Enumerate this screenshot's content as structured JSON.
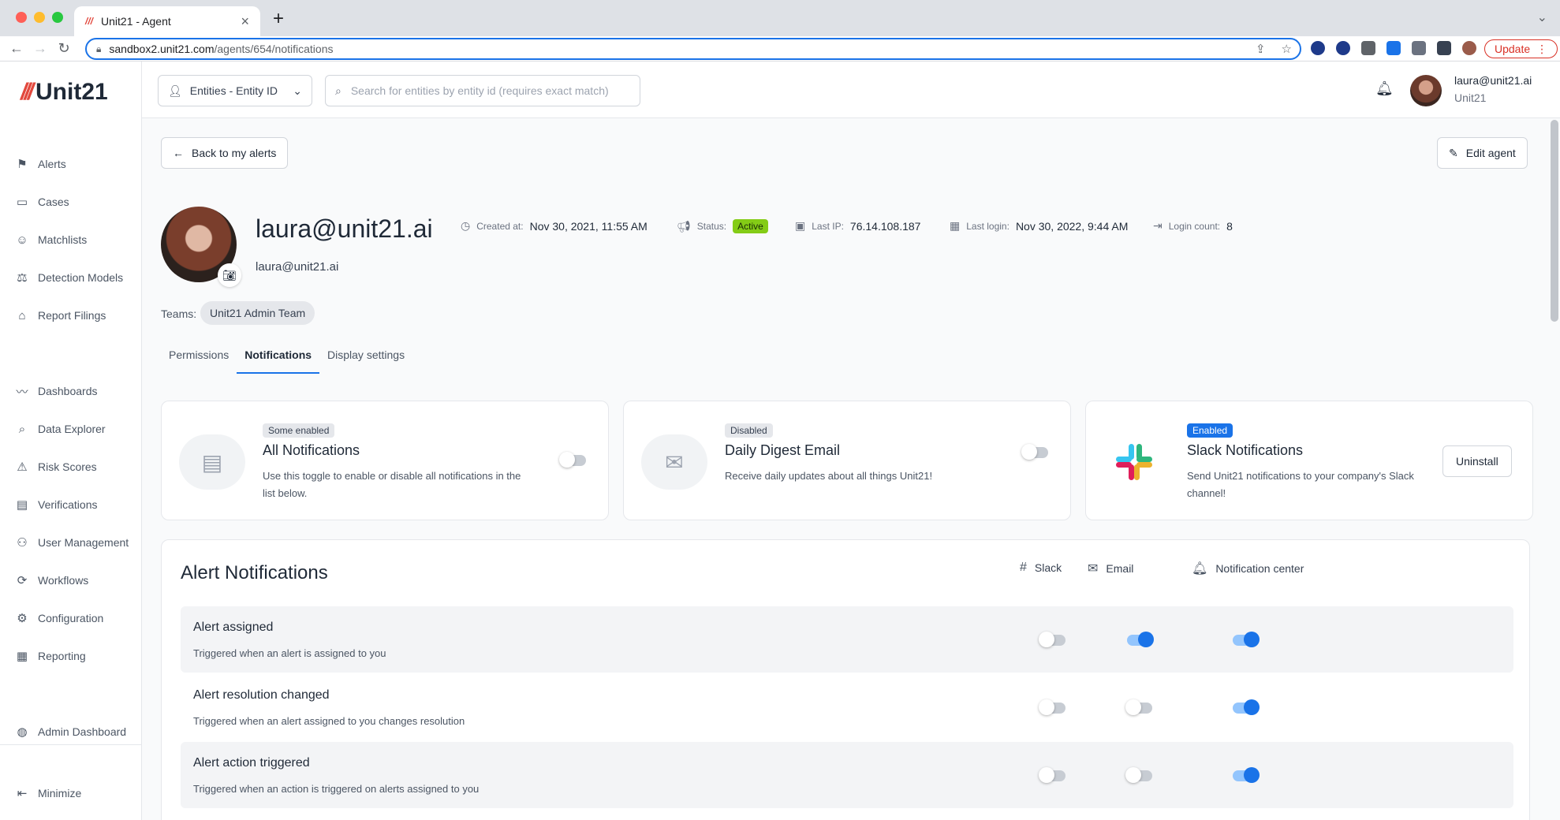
{
  "browser": {
    "tab_title": "Unit21 - Agent",
    "url_host": "sandbox2.unit21.com",
    "url_path": "/agents/654/notifications",
    "update_label": "Update"
  },
  "logo": {
    "mark": "///",
    "text": "Unit21"
  },
  "sidebar": {
    "items": [
      {
        "label": "Alerts",
        "icon": "flag-icon"
      },
      {
        "label": "Cases",
        "icon": "briefcase-icon"
      },
      {
        "label": "Matchlists",
        "icon": "user-x-icon"
      },
      {
        "label": "Detection Models",
        "icon": "scale-icon"
      },
      {
        "label": "Report Filings",
        "icon": "building-icon"
      },
      {
        "label": "Dashboards",
        "icon": "chart-line-icon"
      },
      {
        "label": "Data Explorer",
        "icon": "search-data-icon"
      },
      {
        "label": "Risk Scores",
        "icon": "warning-icon"
      },
      {
        "label": "Verifications",
        "icon": "id-card-icon"
      },
      {
        "label": "User Management",
        "icon": "users-icon"
      },
      {
        "label": "Workflows",
        "icon": "workflow-icon"
      },
      {
        "label": "Configuration",
        "icon": "gear-icon"
      },
      {
        "label": "Reporting",
        "icon": "report-icon"
      },
      {
        "label": "Admin Dashboard",
        "icon": "globe-icon"
      }
    ],
    "minimize_label": "Minimize"
  },
  "topbar": {
    "entity_select_value": "Entities - Entity ID",
    "search_placeholder": "Search for entities by entity id (requires exact match)",
    "user_email": "laura@unit21.ai",
    "user_org": "Unit21"
  },
  "actions": {
    "back_label": "Back to my alerts",
    "edit_label": "Edit agent"
  },
  "profile": {
    "name": "laura@unit21.ai",
    "email": "laura@unit21.ai",
    "created_label": "Created at:",
    "created_value": "Nov 30, 2021, 11:55 AM",
    "status_label": "Status:",
    "status_value": "Active",
    "last_ip_label": "Last IP:",
    "last_ip_value": "76.14.108.187",
    "last_login_label": "Last login:",
    "last_login_value": "Nov 30, 2022, 9:44 AM",
    "login_count_label": "Login count:",
    "login_count_value": "8",
    "teams_label": "Teams:",
    "team": "Unit21 Admin Team"
  },
  "tabs": [
    {
      "label": "Permissions",
      "active": false
    },
    {
      "label": "Notifications",
      "active": true
    },
    {
      "label": "Display settings",
      "active": false
    }
  ],
  "cards": [
    {
      "tag": "Some enabled",
      "title": "All Notifications",
      "desc": "Use this toggle to enable or disable all notifications in the list below.",
      "enabled": false
    },
    {
      "tag": "Disabled",
      "title": "Daily Digest Email",
      "desc": "Receive daily updates about all things Unit21!",
      "enabled": false
    },
    {
      "tag": "Enabled",
      "title": "Slack Notifications",
      "desc": "Send Unit21 notifications to your company's Slack channel!",
      "button": "Uninstall"
    }
  ],
  "alert_notifications": {
    "title": "Alert Notifications",
    "columns": [
      "Slack",
      "Email",
      "Notification center"
    ],
    "rows": [
      {
        "title": "Alert assigned",
        "desc": "Triggered when an alert is assigned to you",
        "slack": false,
        "email": true,
        "center": true
      },
      {
        "title": "Alert resolution changed",
        "desc": "Triggered when an alert assigned to you changes resolution",
        "slack": false,
        "email": false,
        "center": true
      },
      {
        "title": "Alert action triggered",
        "desc": "Triggered when an action is triggered on alerts assigned to you",
        "slack": false,
        "email": false,
        "center": true
      }
    ]
  },
  "colors": {
    "accent": "#1a73e8",
    "active_badge": "#84cc16",
    "logo_mark": "#e2483d"
  }
}
